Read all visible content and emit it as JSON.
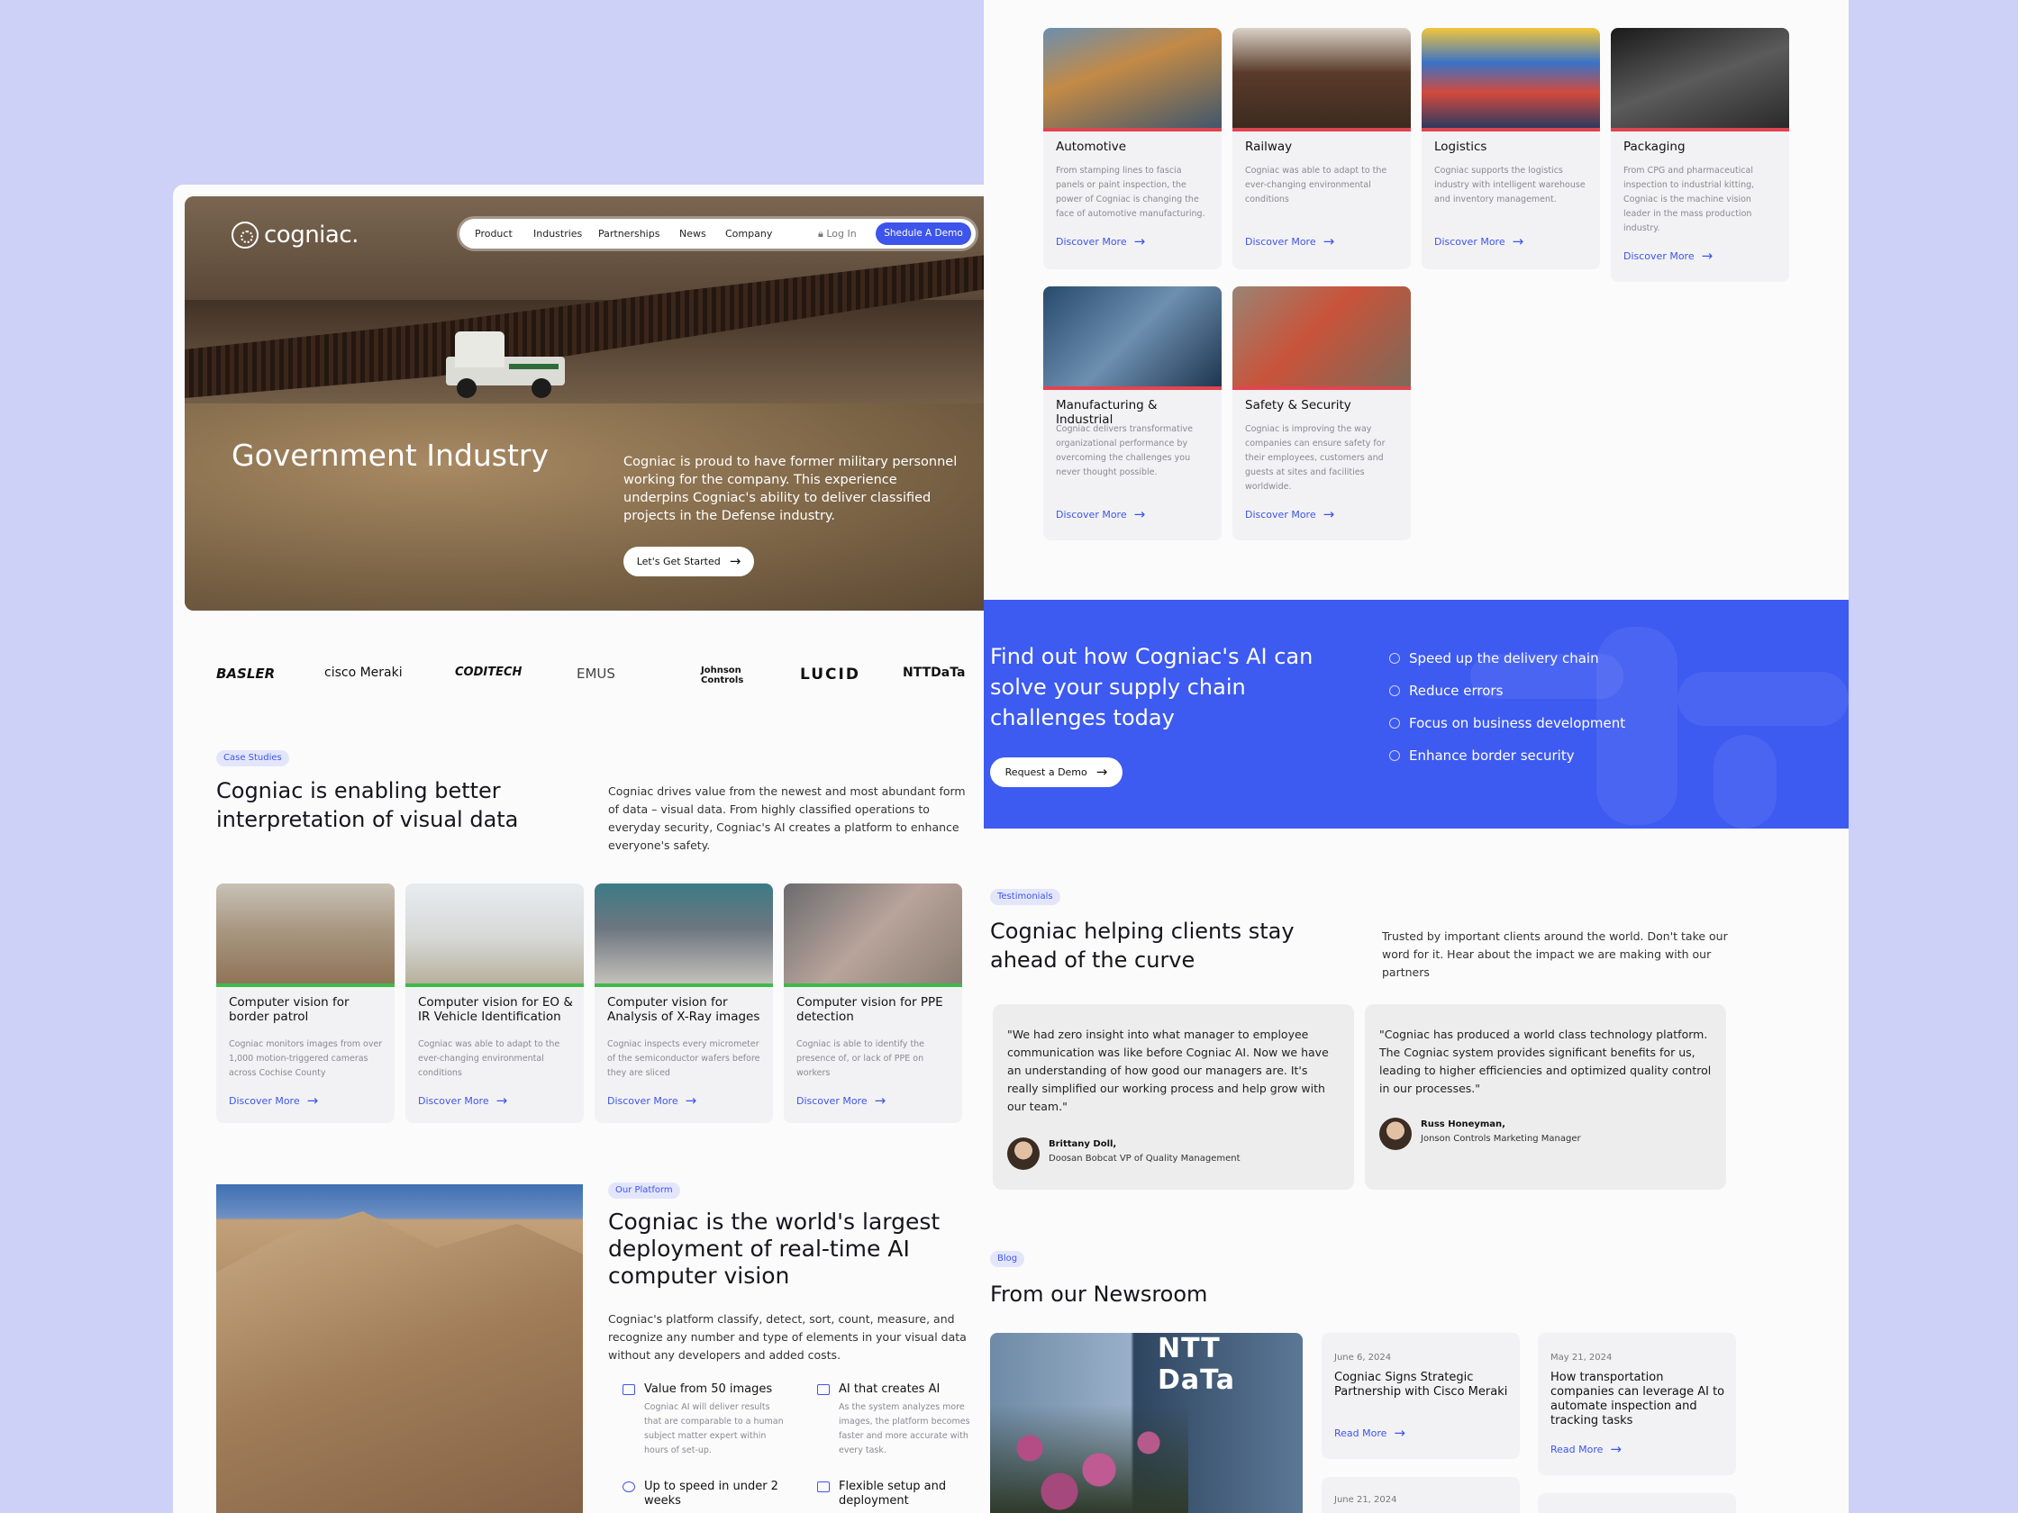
{
  "nav": {
    "logo": "cogniac.",
    "items": [
      "Product",
      "Industries",
      "Partnerships",
      "News",
      "Company"
    ],
    "login": "Log In",
    "demo": "Shedule A Demo"
  },
  "hero": {
    "title": "Government Industry",
    "text": "Cogniac is proud to have former military personnel working for the company. This experience underpins Cogniac's ability to deliver classified projects in the Defense industry.",
    "cta": "Let's Get Started"
  },
  "partners": [
    "BASLER",
    "cisco Meraki",
    "CODITECH",
    "EMUS",
    "Johnson Controls",
    "LUCID",
    "NTTDaTa"
  ],
  "case": {
    "pill": "Case Studies",
    "title": "Cogniac is enabling better interpretation of visual data",
    "text": "Cogniac drives value from the newest and most abundant form of data – visual data. From highly classified operations to everyday security, Cogniac's AI creates a platform to enhance everyone's safety.",
    "cards": [
      {
        "title": "Computer vision for border patrol",
        "desc": "Cogniac monitors images from over 1,000 motion-triggered cameras across Cochise County",
        "more": "Discover More"
      },
      {
        "title": "Computer vision for EO & IR Vehicle Identification",
        "desc": "Cogniac was able to adapt to the ever-changing environmental conditions",
        "more": "Discover More"
      },
      {
        "title": "Computer vision for Analysis of X-Ray images",
        "desc": "Cogniac inspects every micrometer of the semiconductor wafers before they are sliced",
        "more": "Discover More"
      },
      {
        "title": "Computer vision for PPE detection",
        "desc": "Cogniac is able to identify the presence of, or lack of PPE on workers",
        "more": "Discover More"
      }
    ]
  },
  "platform": {
    "pill": "Our Platform",
    "title": "Cogniac is the world's largest deployment of real-time AI computer vision",
    "text": "Cogniac's platform classify, detect, sort, count, measure, and recognize any number and type of elements in your visual data without any developers and added costs.",
    "features": [
      {
        "title": "Value from 50 images",
        "desc": "Cogniac AI will deliver results that are comparable to a human subject matter expert within hours of set-up."
      },
      {
        "title": "AI that creates AI",
        "desc": "As the system analyzes more images, the platform becomes faster and more accurate with every task."
      },
      {
        "title": "Up to speed in under 2 weeks",
        "desc": ""
      },
      {
        "title": "Flexible setup and deployment",
        "desc": ""
      }
    ]
  },
  "industries": [
    {
      "title": "Automotive",
      "desc": "From stamping lines to fascia panels or paint inspection, the power of Cogniac is changing the face of automotive manufacturing.",
      "more": "Discover More"
    },
    {
      "title": "Railway",
      "desc": "Cogniac was able to adapt to the ever-changing environmental conditions",
      "more": "Discover More"
    },
    {
      "title": "Logistics",
      "desc": "Cogniac supports the logistics industry with intelligent warehouse and inventory management.",
      "more": "Discover More"
    },
    {
      "title": "Packaging",
      "desc": "From CPG and pharmaceutical inspection to industrial kitting, Cogniac is the machine vision leader in the mass production industry.",
      "more": "Discover More"
    },
    {
      "title": "Manufacturing & Industrial",
      "desc": "Cogniac delivers transformative organizational performance by overcoming the challenges you never thought possible.",
      "more": "Discover More"
    },
    {
      "title": "Safety & Security",
      "desc": "Cogniac is improving the way companies can ensure safety for their employees, customers and guests at sites and facilities worldwide.",
      "more": "Discover More"
    }
  ],
  "cta": {
    "title": "Find out how Cogniac's AI can solve your supply chain challenges today",
    "button": "Request a Demo",
    "points": [
      "Speed up the delivery chain",
      "Reduce errors",
      "Focus on business development",
      "Enhance border security"
    ]
  },
  "testimonials": {
    "pill": "Testimonials",
    "title": "Cogniac helping clients stay ahead of the curve",
    "text": "Trusted by important clients around the world. Don't take our word for it. Hear about the impact we are making with our partners",
    "items": [
      {
        "quote": "\"We had zero insight into what manager to employee communication was like before Cogniac AI. Now we have an understanding of how good our managers are. It's really simplified our working process and help grow with our team.\"",
        "name": "Brittany Doll,",
        "role": "Doosan Bobcat VP of Quality Management"
      },
      {
        "quote": "\"Cogniac has produced a world class technology platform. The Cogniac system provides significant benefits for us, leading to higher efficiencies and optimized quality control in our processes.\"",
        "name": "Russ Honeyman,",
        "role": "Jonson Controls Marketing Manager"
      }
    ]
  },
  "blog": {
    "pill": "Blog",
    "title": "From our Newsroom",
    "image_sign": "NTT DaTa",
    "items": [
      {
        "date": "June 6, 2024",
        "title": "Cogniac Signs Strategic Partnership with Cisco Meraki",
        "more": "Read More"
      },
      {
        "date": "May 21, 2024",
        "title": "How transportation companies can leverage AI to automate inspection and tracking tasks",
        "more": "Read More"
      },
      {
        "date": "June 21, 2024",
        "title": "",
        "more": ""
      }
    ]
  },
  "colors": {
    "accent": "#3d55ea",
    "cta_bg": "#3d5af1",
    "page_bg": "#cdd0f7",
    "case_bar": "#3fb94b",
    "industry_bar": "#e14450"
  }
}
